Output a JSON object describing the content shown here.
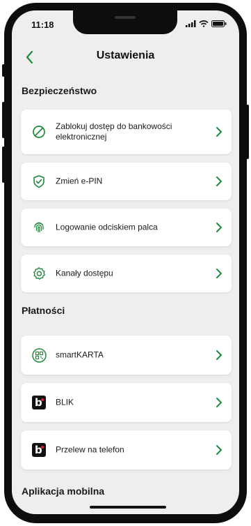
{
  "status_bar": {
    "time": "11:18"
  },
  "header": {
    "title": "Ustawienia"
  },
  "sections": {
    "security": {
      "title": "Bezpieczeństwo",
      "items": [
        {
          "label": "Zablokuj dostęp do bankowości elektronicznej",
          "icon": "block-icon"
        },
        {
          "label": "Zmień e-PIN",
          "icon": "shield-check-icon"
        },
        {
          "label": "Logowanie odciskiem palca",
          "icon": "fingerprint-icon"
        },
        {
          "label": "Kanały dostępu",
          "icon": "gear-icon"
        }
      ]
    },
    "payments": {
      "title": "Płatności",
      "items": [
        {
          "label": "smartKARTA",
          "icon": "qr-code-icon"
        },
        {
          "label": "BLIK",
          "icon": "blik-icon"
        },
        {
          "label": "Przelew na telefon",
          "icon": "blik-icon"
        }
      ]
    },
    "mobile_app": {
      "title": "Aplikacja mobilna"
    }
  },
  "colors": {
    "accent": "#1e8a3c",
    "background": "#eeeeee",
    "card": "#ffffff"
  }
}
